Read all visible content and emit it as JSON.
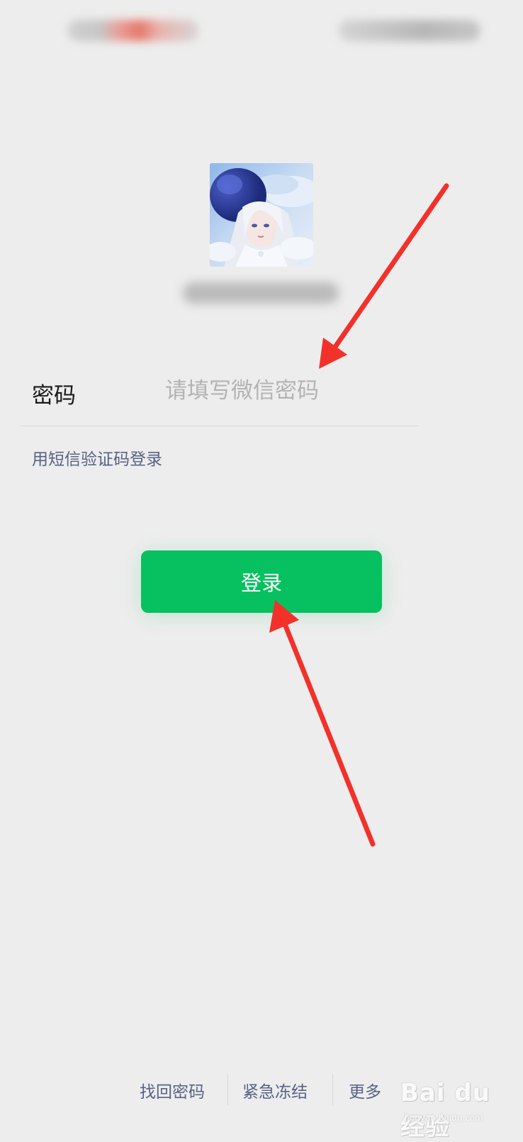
{
  "status_bar": {
    "left_icon": "blurred-status-left",
    "right_icon": "blurred-status-right"
  },
  "profile": {
    "avatar_icon": "anime-girl-avatar",
    "username_icon": "blurred-username"
  },
  "form": {
    "password_label": "密码",
    "password_placeholder": "请填写微信密码",
    "sms_login_link": "用短信验证码登录"
  },
  "login_button": {
    "label": "登录",
    "color": "#07c160"
  },
  "bottom_links": [
    {
      "label": "找回密码"
    },
    {
      "label": "紧急冻结"
    },
    {
      "label": "更多"
    }
  ],
  "annotations": {
    "arrow_color": "#f2312b",
    "arrows": [
      "arrow-to-password-field",
      "arrow-to-login-button"
    ]
  },
  "watermark": {
    "text": "Bai du 经验",
    "url": "jingyan.baidu.com"
  }
}
